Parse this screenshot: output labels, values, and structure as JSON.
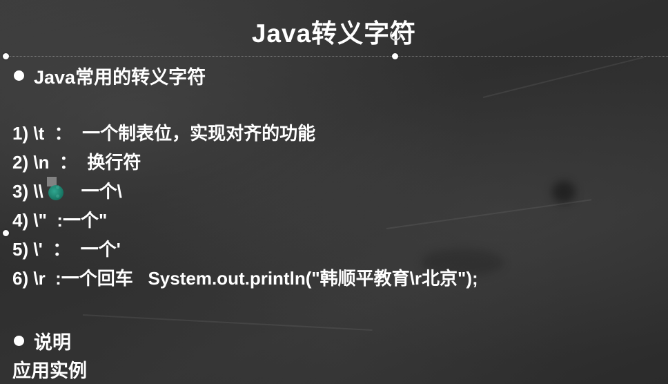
{
  "slide": {
    "title": "Java转义字符",
    "section_heading": "Java常用的转义字符",
    "escape_items": [
      "1) \\t  ：  一个制表位，实现对齐的功能",
      "2) \\n  ：  换行符",
      "3) \\\\  ：  一个\\",
      "4) \\\"  :一个\"",
      "5) \\'  ：  一个'",
      "6) \\r  :一个回车   System.out.println(\"韩顺平教育\\r北京\");"
    ],
    "note_heading": "说明",
    "example_label": "应用实例"
  },
  "colors": {
    "background": "#333333",
    "text": "#ffffff"
  },
  "icons": {
    "bullet": "filled-circle-bullet",
    "selection_handle": "white-dot-handle",
    "rotate_handle": "rotate-arrow-icon",
    "text_cursor": "teal-cursor-icon"
  }
}
